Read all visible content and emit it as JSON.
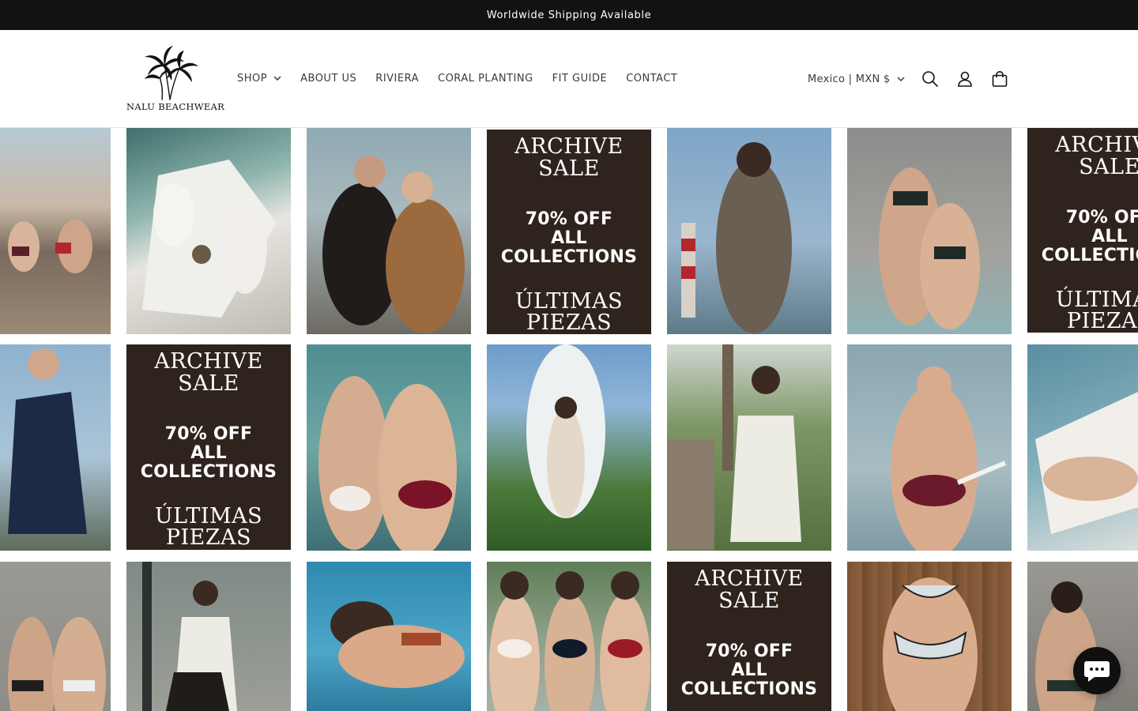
{
  "announcement": {
    "text": "Worldwide Shipping Available"
  },
  "brand": {
    "logo_text": "NALU BEACHWEAR"
  },
  "nav": {
    "items": [
      {
        "label": "SHOP",
        "has_dropdown": true
      },
      {
        "label": "ABOUT US"
      },
      {
        "label": "RIVIERA"
      },
      {
        "label": "CORAL PLANTING"
      },
      {
        "label": "FIT GUIDE"
      },
      {
        "label": "CONTACT"
      }
    ]
  },
  "header": {
    "locale_label": "Mexico | MXN $",
    "icons": [
      "search-icon",
      "account-icon",
      "cart-icon"
    ]
  },
  "sale_banner": {
    "line1": "ARCHIVE",
    "line2": "SALE",
    "line3": "70% OFF",
    "line4": "ALL",
    "line5": "COLLECTIONS",
    "line6": "ÚLTIMAS",
    "line7": "PIEZAS"
  },
  "colors": {
    "announcement_bg": "#121212",
    "sale_bg": "#2f231d",
    "chat_bg": "#101010"
  }
}
